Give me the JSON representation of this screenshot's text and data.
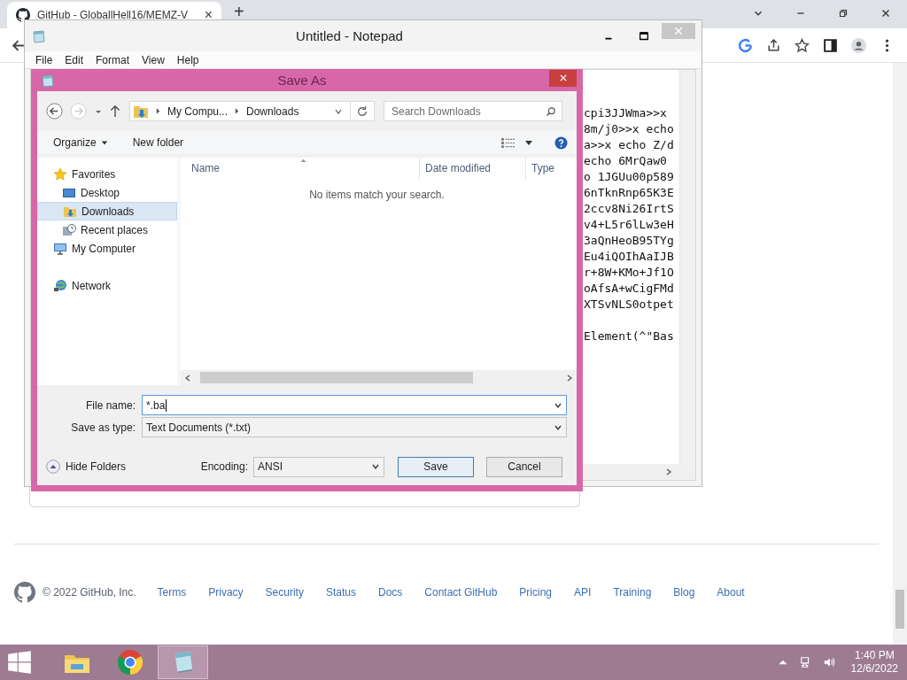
{
  "browser": {
    "tab": {
      "title": "GitHub - GloballHell16/MEMZ-V",
      "close": "×"
    },
    "new_tab": "+",
    "footer": {
      "copyright": "© 2022 GitHub, Inc.",
      "links": [
        "Terms",
        "Privacy",
        "Security",
        "Status",
        "Docs",
        "Contact GitHub",
        "Pricing",
        "API",
        "Training",
        "Blog",
        "About"
      ]
    }
  },
  "notepad": {
    "title": "Untitled - Notepad",
    "menu": [
      "File",
      "Edit",
      "Format",
      "View",
      "Help"
    ],
    "blocks": [
      [
        "cpi3JJWma>>x",
        "8m/j0>>x echo",
        "a>>x echo Z/d",
        "echo 6MrQaw0",
        "o 1JGUu00p589",
        "6nTknRnp65K3E",
        "2ccv8Ni26IrtS",
        "v4+L5r6lLw3eH",
        "3aQnHeoB95TYg",
        "Eu4iQOIhAaIJB",
        "r+8W+KMo+Jf1O",
        "oAfsA+wCigFMd",
        "XTSvNLS0otpet"
      ],
      [
        "Element(^\"Bas"
      ]
    ]
  },
  "save_dialog": {
    "title": "Save As",
    "breadcrumb": [
      "My Compu...",
      "Downloads"
    ],
    "search": {
      "placeholder": "Search Downloads"
    },
    "toolbar": {
      "organize": "Organize",
      "new_folder": "New folder"
    },
    "nav": [
      {
        "label": "Favorites",
        "selected": false,
        "children": [
          {
            "label": "Desktop",
            "selected": false
          },
          {
            "label": "Downloads",
            "selected": true
          },
          {
            "label": "Recent places",
            "selected": false
          }
        ]
      },
      {
        "label": "My Computer",
        "selected": false
      },
      {
        "label": "Network",
        "selected": false
      }
    ],
    "columns": [
      "Name",
      "Date modified",
      "Type"
    ],
    "empty_message": "No items match your search.",
    "file_name": {
      "label": "File name:",
      "value": "*.ba"
    },
    "save_as_type": {
      "label": "Save as type:",
      "value": "Text Documents (*.txt)"
    },
    "hide_folders": "Hide Folders",
    "encoding": {
      "label": "Encoding:",
      "value": "ANSI"
    },
    "buttons": [
      {
        "label": "Save",
        "default": true
      },
      {
        "label": "Cancel",
        "default": false
      }
    ]
  },
  "taskbar": {
    "apps": [
      {
        "selected": false
      },
      {
        "selected": false
      },
      {
        "selected": true
      }
    ],
    "time": "1:40 PM",
    "date": "12/6/2022"
  }
}
